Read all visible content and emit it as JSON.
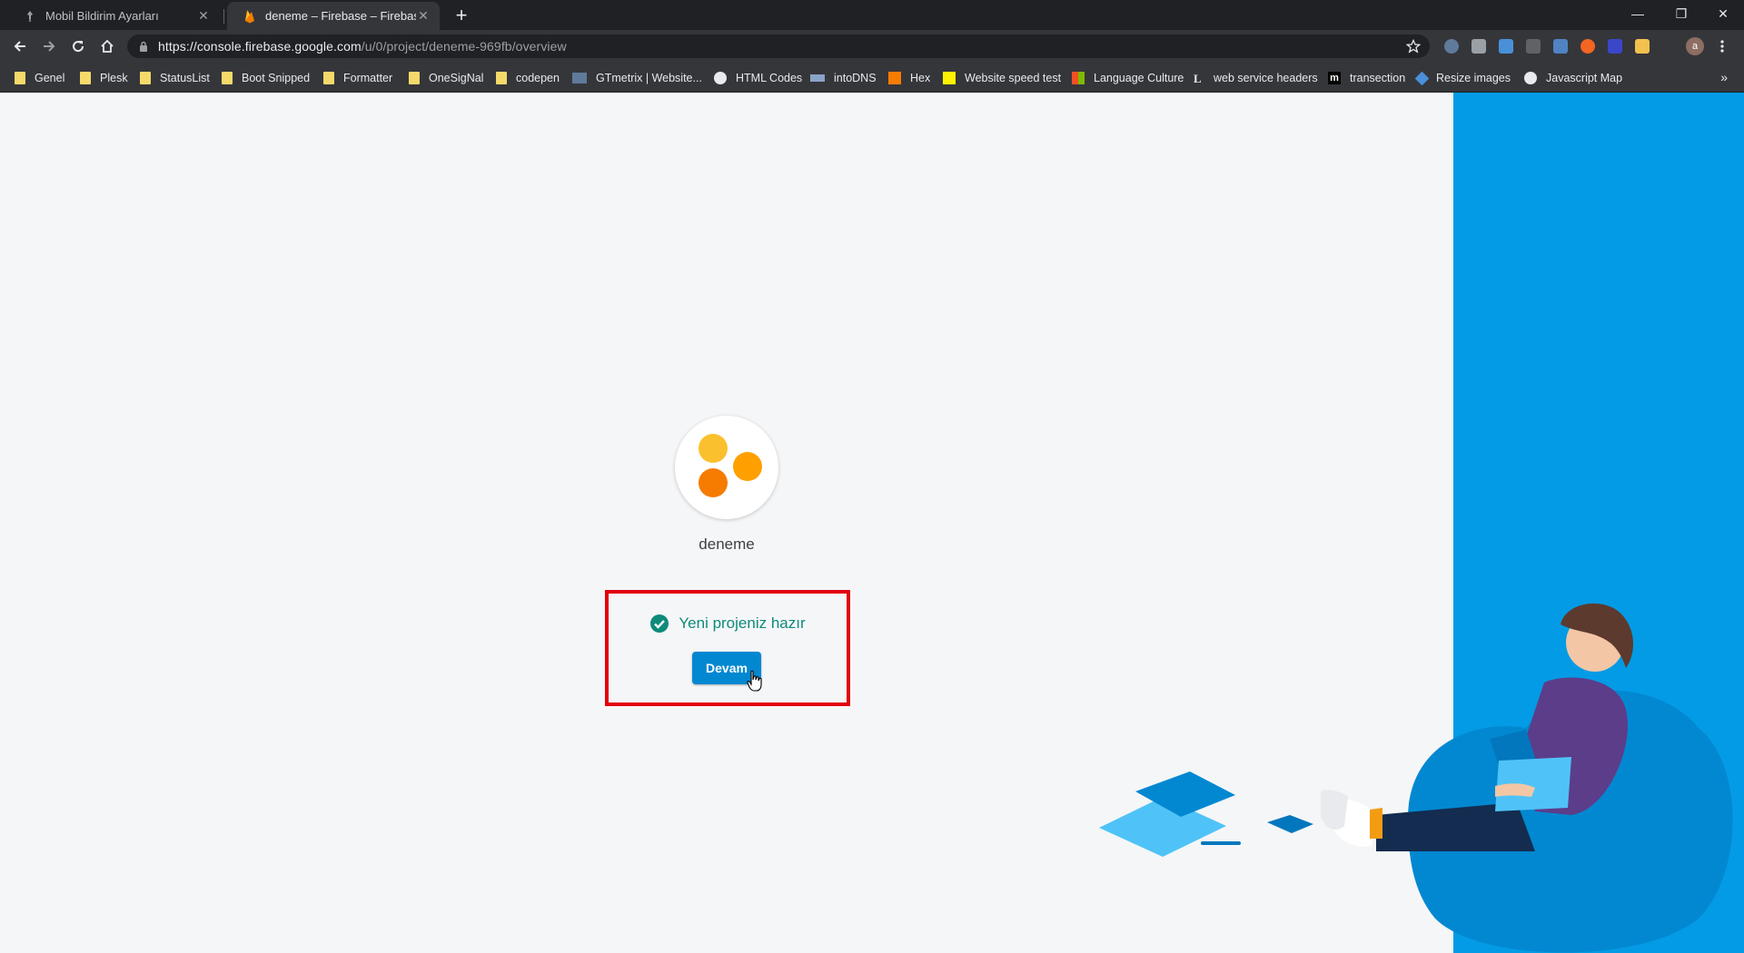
{
  "browser": {
    "tabs": [
      {
        "title": "Mobil Bildirim Ayarları",
        "active": false,
        "icon": "pin-icon"
      },
      {
        "title": "deneme – Firebase – Firebase co",
        "active": true,
        "icon": "firebase-icon"
      }
    ],
    "new_tab_label": "+",
    "window_controls": {
      "minimize": "—",
      "restore": "❐",
      "close": "✕"
    },
    "url_host": "https://console.firebase.google.com",
    "url_path": "/u/0/project/deneme-969fb/overview",
    "avatar_letter": "a",
    "bookmarks": [
      {
        "label": "Genel",
        "icon": "folder-icon"
      },
      {
        "label": "Plesk",
        "icon": "folder-icon"
      },
      {
        "label": "StatusList",
        "icon": "folder-icon"
      },
      {
        "label": "Boot Snipped",
        "icon": "folder-icon"
      },
      {
        "label": "Formatter",
        "icon": "folder-icon"
      },
      {
        "label": "OneSigNal",
        "icon": "folder-icon"
      },
      {
        "label": "codepen",
        "icon": "folder-icon"
      },
      {
        "label": "GTmetrix | Website...",
        "icon": "gtmetrix-icon"
      },
      {
        "label": "HTML Codes",
        "icon": "globe-icon"
      },
      {
        "label": "intoDNS",
        "icon": "dns-icon"
      },
      {
        "label": "Hex",
        "icon": "hex-icon"
      },
      {
        "label": "Website speed test",
        "icon": "pingdom-icon"
      },
      {
        "label": "Language Culture",
        "icon": "windows-icon"
      },
      {
        "label": "web service headers",
        "icon": "l-icon"
      },
      {
        "label": "transection",
        "icon": "m-icon"
      },
      {
        "label": "Resize images",
        "icon": "tag-icon"
      },
      {
        "label": "Javascript Map",
        "icon": "globe-icon"
      }
    ],
    "bookmarks_more": "»"
  },
  "project": {
    "name": "deneme",
    "status_text": "Yeni projeniz hazır",
    "continue_label": "Devam"
  },
  "colors": {
    "accent_blue": "#039be5",
    "button_blue": "#0288d1",
    "success_teal": "#0d8b7a",
    "highlight_red": "#e3000f",
    "logo_yellow": "#fbc02d",
    "logo_amber": "#ffa000",
    "logo_orange": "#f57c00"
  }
}
